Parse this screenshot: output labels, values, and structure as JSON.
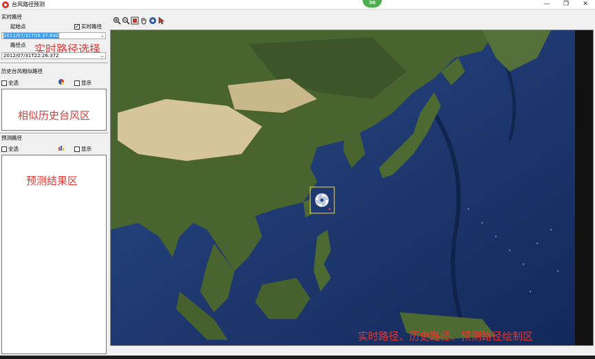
{
  "window": {
    "title": "台风路径预测",
    "badge": "30",
    "controls": {
      "minimize": "—",
      "maximize": "❐",
      "close": "✕"
    }
  },
  "realtime": {
    "section_label": "实时路径",
    "start_label": "起始点",
    "realtime_checkbox_label": "实时路径",
    "realtime_checked": true,
    "start_value": "2012/07/31T09:37:840",
    "path_label": "路径点",
    "path_value": "2012/07/31T22:26:372",
    "overlay": "实时路径选择"
  },
  "history": {
    "section_label": "历史台风相似路径",
    "select_all_label": "全选",
    "show_label": "显示",
    "overlay": "相似历史台风区"
  },
  "prediction": {
    "section_label": "预测路径",
    "select_all_label": "全选",
    "show_label": "显示",
    "overlay": "预测结果区"
  },
  "toolbar": {
    "icons": [
      "zoom-in-icon",
      "zoom-out-icon",
      "full-extent-icon",
      "pan-hand-icon",
      "identify-icon",
      "select-arrow-icon"
    ]
  },
  "map": {
    "caption": "实时路径、历史路径、预测路径绘制区",
    "colors": {
      "ocean": "#1f3a6e",
      "deep_ocean": "#0f2247",
      "land": "#4d6630",
      "desert": "#d6c59a",
      "marker_border": "#d4c44a"
    }
  }
}
